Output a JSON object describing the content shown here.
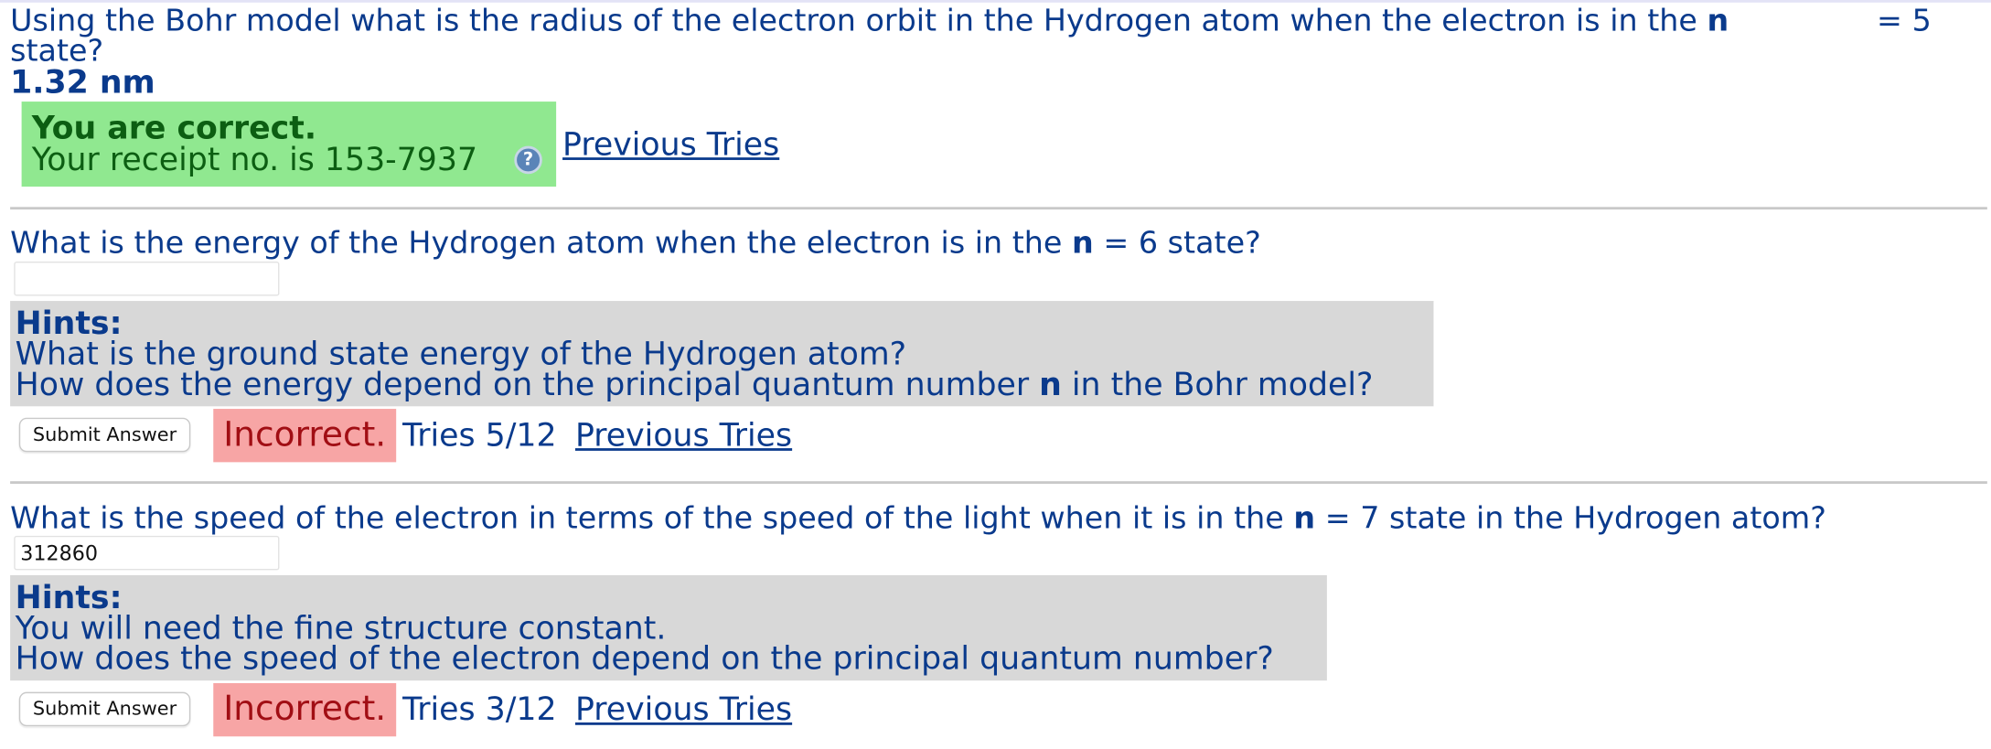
{
  "q1": {
    "text_part1": "Using the Bohr model what is the radius of the electron orbit in the Hydrogen atom when the electron is in the ",
    "n": "n",
    "text_part2": " = 5 state?",
    "answer": "1.32 nm",
    "correct_title": "You are correct.",
    "receipt": "Your receipt no. is 153-7937",
    "help_icon_glyph": "?",
    "previous_tries": "Previous Tries"
  },
  "q2": {
    "text_part1": "What is the energy of the Hydrogen atom when the electron is in the ",
    "n": "n",
    "text_part2": " = 6 state?",
    "input_value": "",
    "hints_title": "Hints:",
    "hint1": "What is the ground state energy of the Hydrogen atom?",
    "hint2_part1": "How does the energy depend on the principal quantum number ",
    "hint2_n": "n",
    "hint2_part2": " in the Bohr model?",
    "submit_label": "Submit Answer",
    "status": "Incorrect.",
    "tries": "Tries 5/12",
    "previous_tries": "Previous Tries"
  },
  "q3": {
    "text_part1": "What is the speed of the electron in terms of the speed of the light when it is in the ",
    "n": "n",
    "text_part2": " = 7 state in the Hydrogen atom?",
    "input_value": "312860",
    "hints_title": "Hints:",
    "hint1": "You will need the fine structure constant.",
    "hint2": "How does the speed of the electron depend on the principal quantum number?",
    "submit_label": "Submit Answer",
    "status": "Incorrect.",
    "tries": "Tries 3/12",
    "previous_tries": "Previous Tries"
  },
  "colors": {
    "text": "#0a3a8c",
    "correct_bg": "#90e890",
    "correct_text": "#0c5e12",
    "incorrect_bg": "#f7a5a5",
    "incorrect_text": "#a10e14",
    "hints_bg": "#d8d8d8"
  }
}
